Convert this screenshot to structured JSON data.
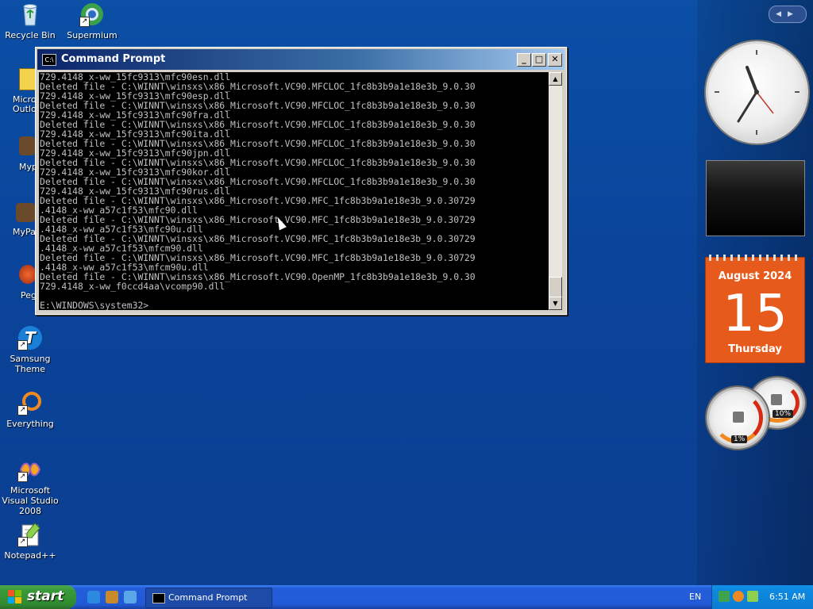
{
  "desktop_icons": [
    {
      "label": "Recycle Bin"
    },
    {
      "label": "Supermium"
    },
    {
      "label": "Samsung Theme"
    },
    {
      "label": "Everything"
    },
    {
      "label": "Microsoft Visual Studio 2008"
    },
    {
      "label": "Notepad++"
    }
  ],
  "partial_icons": [
    {
      "label": "Micros\nOutlo"
    },
    {
      "label": "Myp"
    },
    {
      "label": "MyPa"
    },
    {
      "label": "Peg"
    }
  ],
  "window": {
    "title": "Command Prompt",
    "icon_text": "C:\\",
    "minimize": "_",
    "maximize": "□",
    "close": "✕",
    "console_text": "729.4148_x-ww_15fc9313\\mfc90esn.dll\nDeleted file - C:\\WINNT\\winsxs\\x86_Microsoft.VC90.MFCLOC_1fc8b3b9a1e18e3b_9.0.30\n729.4148_x-ww_15fc9313\\mfc90esp.dll\nDeleted file - C:\\WINNT\\winsxs\\x86_Microsoft.VC90.MFCLOC_1fc8b3b9a1e18e3b_9.0.30\n729.4148_x-ww_15fc9313\\mfc90fra.dll\nDeleted file - C:\\WINNT\\winsxs\\x86_Microsoft.VC90.MFCLOC_1fc8b3b9a1e18e3b_9.0.30\n729.4148_x-ww_15fc9313\\mfc90ita.dll\nDeleted file - C:\\WINNT\\winsxs\\x86_Microsoft.VC90.MFCLOC_1fc8b3b9a1e18e3b_9.0.30\n729.4148_x-ww_15fc9313\\mfc90jpn.dll\nDeleted file - C:\\WINNT\\winsxs\\x86_Microsoft.VC90.MFCLOC_1fc8b3b9a1e18e3b_9.0.30\n729.4148_x-ww_15fc9313\\mfc90kor.dll\nDeleted file - C:\\WINNT\\winsxs\\x86_Microsoft.VC90.MFCLOC_1fc8b3b9a1e18e3b_9.0.30\n729.4148_x-ww_15fc9313\\mfc90rus.dll\nDeleted file - C:\\WINNT\\winsxs\\x86_Microsoft.VC90.MFC_1fc8b3b9a1e18e3b_9.0.30729\n.4148_x-ww_a57c1f53\\mfc90.dll\nDeleted file - C:\\WINNT\\winsxs\\x86_Microsoft.VC90.MFC_1fc8b3b9a1e18e3b_9.0.30729\n.4148_x-ww_a57c1f53\\mfc90u.dll\nDeleted file - C:\\WINNT\\winsxs\\x86_Microsoft.VC90.MFC_1fc8b3b9a1e18e3b_9.0.30729\n.4148_x-ww_a57c1f53\\mfcm90.dll\nDeleted file - C:\\WINNT\\winsxs\\x86_Microsoft.VC90.MFC_1fc8b3b9a1e18e3b_9.0.30729\n.4148_x-ww_a57c1f53\\mfcm90u.dll\nDeleted file - C:\\WINNT\\winsxs\\x86_Microsoft.VC90.OpenMP_1fc8b3b9a1e18e3b_9.0.30\n729.4148_x-ww_f0ccd4aa\\vcomp90.dll\n\nE:\\WINDOWS\\system32>",
    "scroll_up": "▲",
    "scroll_down": "▼"
  },
  "gadgets": {
    "nav_arrows": "◀▶",
    "calendar": {
      "month": "August 2024",
      "day": "15",
      "weekday": "Thursday"
    },
    "meters": {
      "cpu": "1%",
      "memory": "10%"
    }
  },
  "taskbar": {
    "start_label": "start",
    "task_button": "Command Prompt",
    "language": "EN",
    "time": "6:51 AM"
  },
  "colors": {
    "desktop": "#0a449a",
    "taskbar": "#245edb",
    "start": "#3a9b3a",
    "calendar": "#e65a1b"
  }
}
